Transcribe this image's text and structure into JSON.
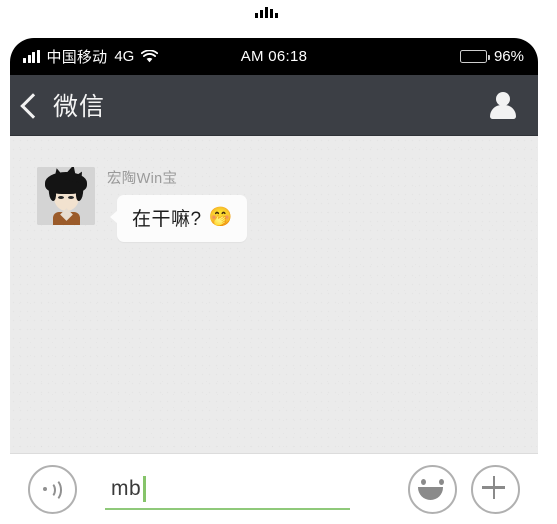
{
  "notch": {
    "icon": "signal-bars-decoration"
  },
  "status_bar": {
    "carrier": "中国移动",
    "network": "4G",
    "wifi_icon": "wifi-icon",
    "signal_icon": "signal-bars-icon",
    "time": "AM 06:18",
    "battery_percent": "96%",
    "battery_icon": "battery-icon"
  },
  "nav_bar": {
    "back_icon": "back-chevron-icon",
    "title": "微信",
    "profile_icon": "person-icon"
  },
  "chat": {
    "messages": [
      {
        "sender": "宏陶Win宝",
        "avatar_icon": "anime-character-avatar",
        "text": "在干嘛?",
        "emoji": "🤭",
        "side": "incoming"
      }
    ]
  },
  "input_bar": {
    "voice_icon": "voice-wave-icon",
    "text_value": "mb",
    "placeholder": "",
    "emoji_icon": "smiley-face-icon",
    "add_icon": "plus-icon"
  },
  "colors": {
    "status_bar_bg": "#000000",
    "nav_bar_bg": "#3c3f45",
    "chat_bg": "#ebebeb",
    "bubble_bg": "#fcfcfc",
    "accent_green": "#8fc97a",
    "sender_name": "#9a9a9a"
  }
}
